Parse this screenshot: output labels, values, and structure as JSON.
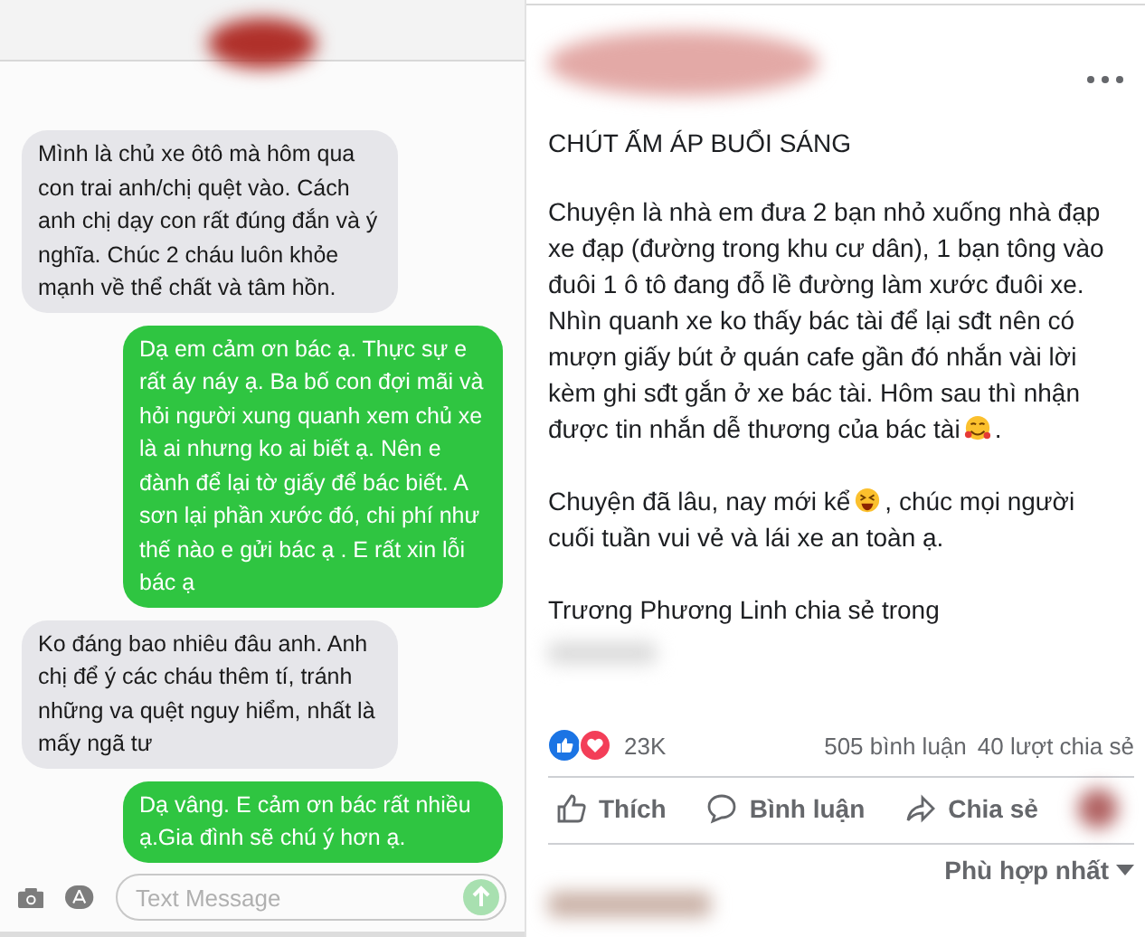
{
  "messages": {
    "bubbles": [
      {
        "kind": "incoming",
        "text": "Mình là chủ xe ôtô mà hôm qua con trai anh/chị quệt vào.  Cách anh chị dạy con rất đúng đắn và ý nghĩa. Chúc 2 cháu luôn khỏe mạnh về thể chất và tâm hồn."
      },
      {
        "kind": "outgoing",
        "text": "Dạ em cảm ơn bác ạ. Thực sự e rất áy náy ạ. Ba bố con đợi mãi và hỏi người xung quanh xem chủ xe là ai nhưng ko ai biết ạ. Nên e đành để lại tờ giấy để bác biết. A sơn lại phần xước đó, chi phí như thế nào e gửi bác ạ . E rất xin lỗi bác ạ"
      },
      {
        "kind": "incoming",
        "text": "Ko đáng bao nhiêu đâu anh. Anh chị để ý các cháu thêm tí, tránh những va quệt nguy hiểm, nhất là mấy ngã tư"
      },
      {
        "kind": "outgoing",
        "text": "Dạ vâng. E cảm ơn bác rất nhiều ạ.Gia đình sẽ chú ý hơn ạ."
      }
    ],
    "composer": {
      "placeholder": "Text Message"
    }
  },
  "post": {
    "title": "CHÚT ẤM ÁP BUỔI SÁNG",
    "paragraphs": [
      [
        {
          "kind": "text",
          "text": "Chuyện là nhà em đưa 2 bạn nhỏ xuống nhà đạp xe đạp (đường trong khu cư dân), 1 bạn tông vào đuôi 1 ô tô đang đỗ lề đường làm xước đuôi xe. Nhìn quanh xe ko thấy bác tài để lại sđt nên có mượn giấy bút ở quán cafe gần đó nhắn vài lời kèm ghi sđt gắn ở xe bác tài. Hôm sau thì nhận được tin nhắn dễ thương của bác tài"
        },
        {
          "kind": "hearts_emoji"
        },
        {
          "kind": "text",
          "text": "."
        }
      ],
      [
        {
          "kind": "text",
          "text": "Chuyện đã lâu, nay mới kể"
        },
        {
          "kind": "laugh_emoji"
        },
        {
          "kind": "text",
          "text": ", chúc mọi người cuối tuần vui vẻ và lái xe an toàn ạ."
        }
      ]
    ],
    "shared_in": "Trương Phương Linh chia sẻ trong",
    "reactions": {
      "count": "23K",
      "comments": "505 bình luận",
      "shares": "40 lượt chia sẻ"
    },
    "actions": [
      {
        "kind": "like",
        "label": "Thích"
      },
      {
        "kind": "comment",
        "label": "Bình luận"
      },
      {
        "kind": "share",
        "label": "Chia sẻ"
      }
    ],
    "sort": "Phù hợp nhất"
  }
}
